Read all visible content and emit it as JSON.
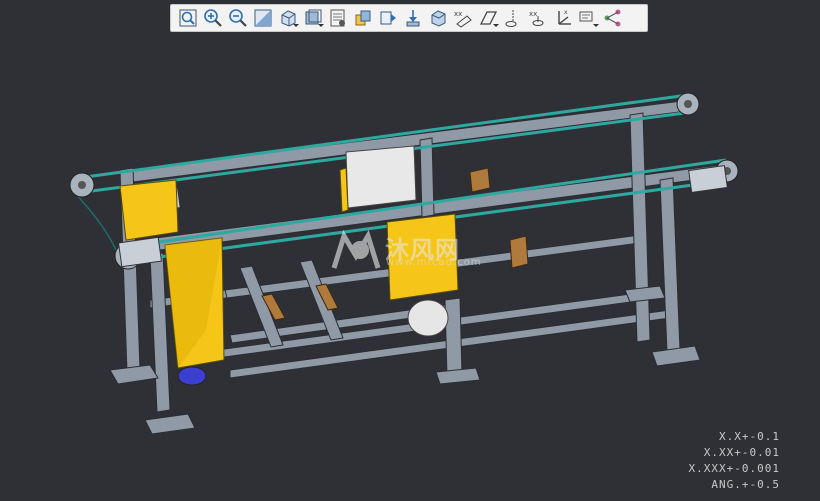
{
  "toolbar": {
    "buttons": [
      {
        "name": "refit-icon",
        "label": "Refit"
      },
      {
        "name": "zoom-in-icon",
        "label": "Zoom In"
      },
      {
        "name": "zoom-out-icon",
        "label": "Zoom Out"
      },
      {
        "name": "repaint-icon",
        "label": "Repaint"
      },
      {
        "name": "orient-icon",
        "label": "Saved Orientations"
      },
      {
        "name": "display-style-icon",
        "label": "Display Style"
      },
      {
        "name": "named-views-icon",
        "label": "Named Views"
      },
      {
        "name": "section-icon",
        "label": "View Manager"
      },
      {
        "name": "perspective-icon",
        "label": "Perspective View"
      },
      {
        "name": "spin-center-icon",
        "label": "Spin Center"
      },
      {
        "name": "model-display-icon",
        "label": "Model Display"
      },
      {
        "name": "plane-display-icon",
        "label": "Plane Display"
      },
      {
        "name": "axis-display-icon",
        "label": "Axis Display"
      },
      {
        "name": "point-display-icon",
        "label": "Point Display"
      },
      {
        "name": "csys-display-icon",
        "label": "Coordinate System Display"
      },
      {
        "name": "annotation-display-icon",
        "label": "Annotation Display"
      },
      {
        "name": "network-icon",
        "label": "Network"
      }
    ]
  },
  "tolerances": {
    "line1": "X.X+-0.1",
    "line2": "X.XX+-0.01",
    "line3": "X.XXX+-0.001",
    "line4": "ANG.+-0.5"
  },
  "watermark": {
    "text": "沐风网",
    "url": "www.mfcad.com"
  },
  "colors": {
    "background": "#2f3035",
    "frame": "#8f9aa6",
    "belt": "#2ea8a0",
    "guard": "#f5c518",
    "wood": "#b07a3c"
  }
}
